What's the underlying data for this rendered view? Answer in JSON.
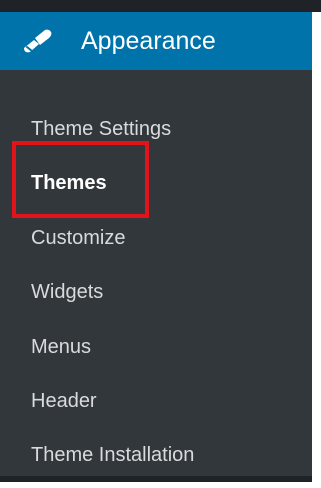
{
  "menu": {
    "parent_label": "Appearance",
    "parent_icon": "paintbrush-icon",
    "submenu": [
      {
        "label": "Theme Settings"
      },
      {
        "label": "Themes"
      },
      {
        "label": "Customize"
      },
      {
        "label": "Widgets"
      },
      {
        "label": "Menus"
      },
      {
        "label": "Header"
      },
      {
        "label": "Theme Installation"
      }
    ],
    "active_item": "Themes"
  },
  "colors": {
    "menu_background": "#32373c",
    "active_parent_background": "#0073aa",
    "highlight_outline": "#e2141b",
    "text": "#d8dadc"
  }
}
